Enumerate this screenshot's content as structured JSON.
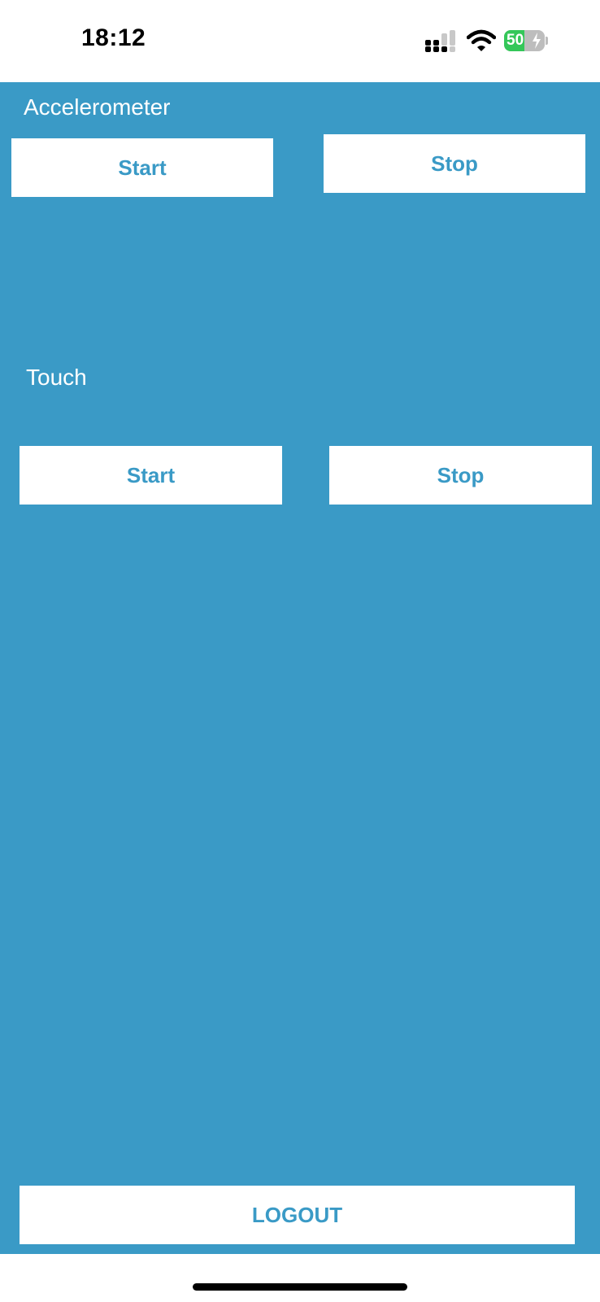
{
  "status_bar": {
    "time": "18:12",
    "battery_level": "50",
    "battery_fraction": 0.5,
    "signal_icon": "cellular-signal-icon",
    "wifi_icon": "wifi-icon",
    "charging_icon": "bolt-icon"
  },
  "colors": {
    "background": "#3a9ac6",
    "button_bg": "#ffffff",
    "button_text": "#3a9ac6",
    "battery_green": "#34c759"
  },
  "accelerometer": {
    "label": "Accelerometer",
    "start_label": "Start",
    "stop_label": "Stop"
  },
  "touch": {
    "label": "Touch",
    "start_label": "Start",
    "stop_label": "Stop"
  },
  "logout_label": "LOGOUT"
}
